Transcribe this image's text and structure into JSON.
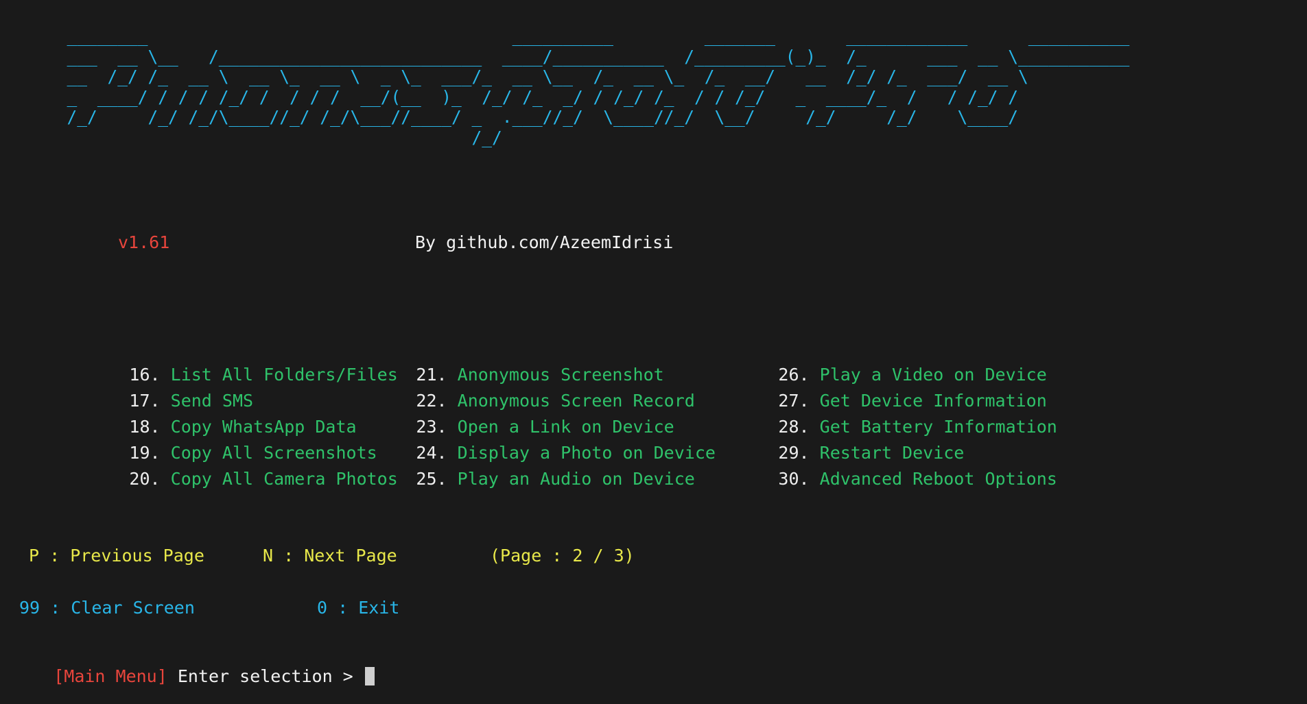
{
  "terminal": {
    "background_color": "#1a1a1a",
    "banner_color": "#29b6e8",
    "green": "#2fc26a",
    "red": "#e8453c",
    "yellow": "#e8e84a",
    "cyan": "#29b6e8",
    "white": "#f2f2f2"
  },
  "banner": {
    "name": "phonesploit-pro-ascii-logo",
    "art": "  ________                                    __________         _______       ____________      __________\n  ___  __ \\__   /__________________________  ____/___________  /_________(_)_  /_      ___  __ \\___________\n  __  /_/ /_  __ \\  __ \\_  __ \\  _ \\_  ___/_  __ \\__  /_  __ \\_  /_  __/   __  /_/ /_  ___/  __ \\\n  _  ____/ / / / /_/ /  / / /  __/(__  )_  /_/ /_  _/ / /_/ /_  / / /_/   _  ____/_  /   / /_/ /\n  /_/     /_/ /_/\\____//_/ /_/\\___//____/ _  .___//_/  \\____//_/  \\__/     /_/     /_/    \\____/\n                                          /_/"
  },
  "header": {
    "version": "v1.61",
    "author": "By github.com/AzeemIdrisi"
  },
  "menu": {
    "columns": [
      {
        "items": [
          {
            "num": "16.",
            "label": "List All Folders/Files"
          },
          {
            "num": "17.",
            "label": "Send SMS"
          },
          {
            "num": "18.",
            "label": "Copy WhatsApp Data"
          },
          {
            "num": "19.",
            "label": "Copy All Screenshots"
          },
          {
            "num": "20.",
            "label": "Copy All Camera Photos"
          }
        ]
      },
      {
        "items": [
          {
            "num": "21.",
            "label": "Anonymous Screenshot"
          },
          {
            "num": "22.",
            "label": "Anonymous Screen Record"
          },
          {
            "num": "23.",
            "label": "Open a Link on Device"
          },
          {
            "num": "24.",
            "label": "Display a Photo on Device"
          },
          {
            "num": "25.",
            "label": "Play an Audio on Device"
          }
        ]
      },
      {
        "items": [
          {
            "num": "26.",
            "label": "Play a Video on Device"
          },
          {
            "num": "27.",
            "label": "Get Device Information"
          },
          {
            "num": "28.",
            "label": "Get Battery Information"
          },
          {
            "num": "29.",
            "label": "Restart Device"
          },
          {
            "num": "30.",
            "label": "Advanced Reboot Options"
          }
        ]
      }
    ]
  },
  "navigation": {
    "previous_page": "P : Previous Page",
    "next_page": "N : Next Page",
    "page_indicator": "(Page : 2 / 3)",
    "current_page": 2,
    "total_pages": 3
  },
  "utilities": {
    "clear_screen": "99 : Clear Screen",
    "exit": "0 : Exit"
  },
  "prompt": {
    "tag": "[Main Menu]",
    "text": " Enter selection > ",
    "input_value": ""
  }
}
